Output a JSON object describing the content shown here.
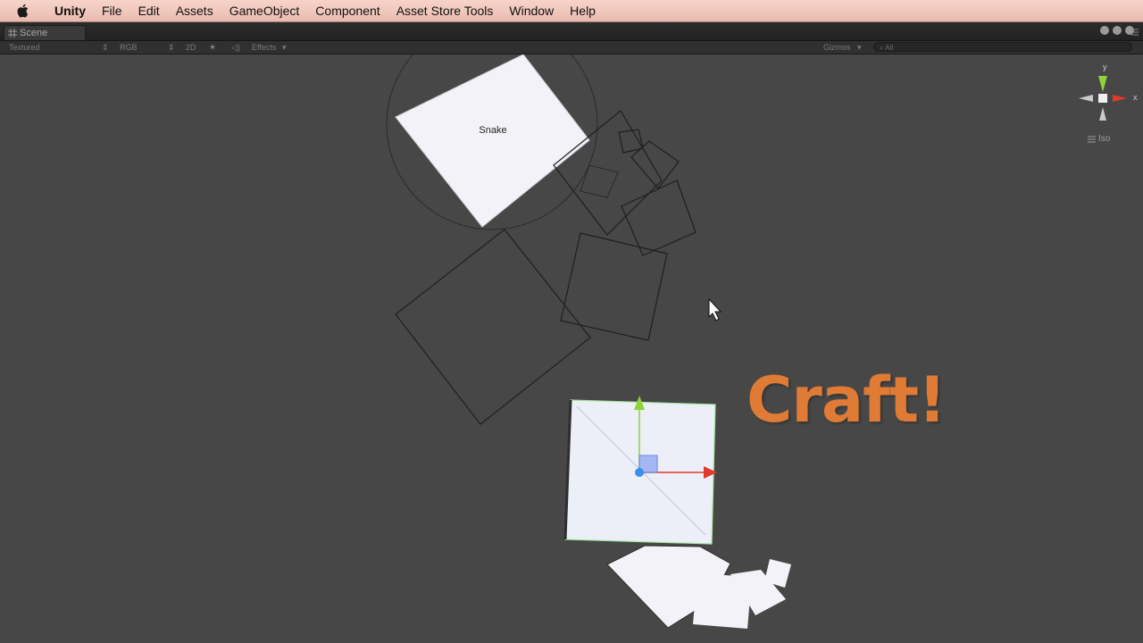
{
  "menubar": {
    "app_name": "Unity",
    "items": [
      "File",
      "Edit",
      "Assets",
      "GameObject",
      "Component",
      "Asset Store Tools",
      "Window",
      "Help"
    ]
  },
  "scene_tab": {
    "label": "Scene"
  },
  "toolbar": {
    "render_mode": "Textured",
    "color_mode": "RGB",
    "mode_2d": "2D",
    "effects": "Effects",
    "gizmos": "Gizmos",
    "search_placeholder": "All"
  },
  "scene": {
    "selected_label": "Snake",
    "overlay_text": "Craft!",
    "projection": "Iso",
    "axis_y": "y",
    "axis_x": "x"
  },
  "colors": {
    "scene_bg": "#474747",
    "menubar_bg": "#f0c6bb",
    "craft_orange": "#e07b35",
    "axis_x": "#e03a2a",
    "axis_y": "#8fd23b",
    "pivot": "#3a8fe8"
  }
}
